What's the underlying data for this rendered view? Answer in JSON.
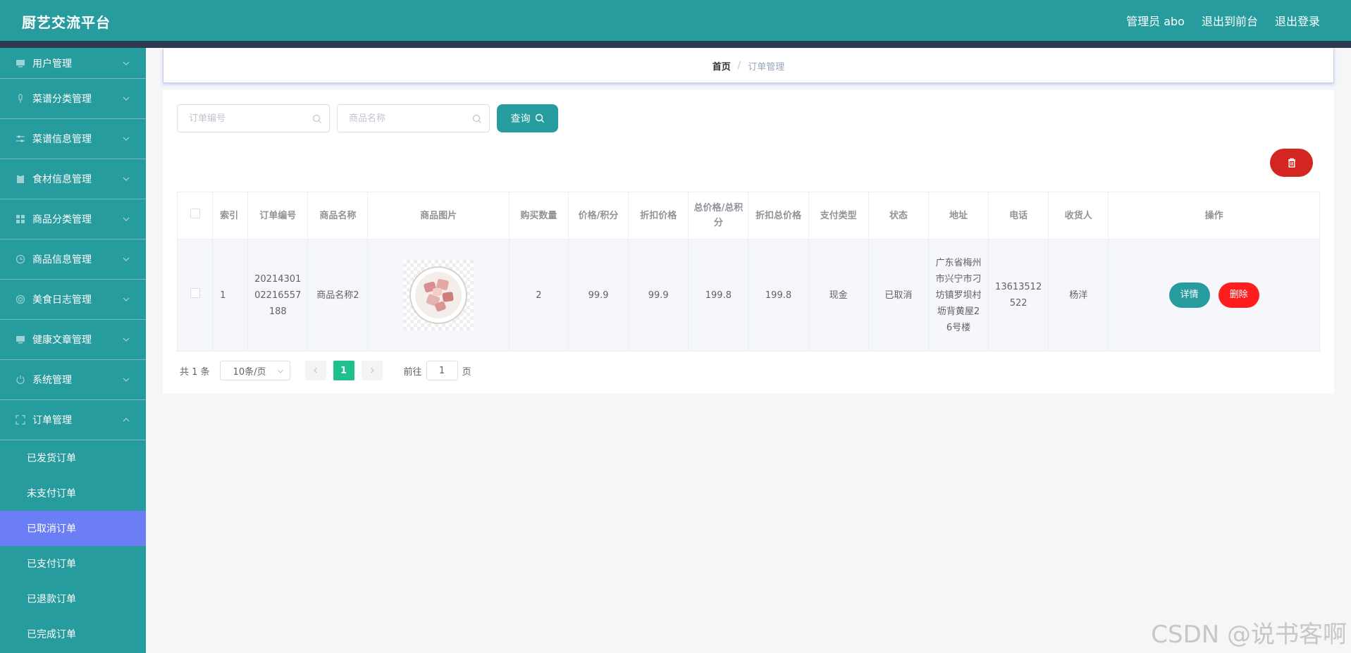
{
  "header": {
    "brand": "厨艺交流平台",
    "admin": "管理员 abo",
    "to_front": "退出到前台",
    "logout": "退出登录"
  },
  "sidebar": {
    "items": [
      {
        "label": "用户管理",
        "icon": "monitor-icon"
      },
      {
        "label": "菜谱分类管理",
        "icon": "microphone-icon"
      },
      {
        "label": "菜谱信息管理",
        "icon": "sliders-icon"
      },
      {
        "label": "食材信息管理",
        "icon": "clipboard-icon"
      },
      {
        "label": "商品分类管理",
        "icon": "grid-icon"
      },
      {
        "label": "商品信息管理",
        "icon": "clock-icon"
      },
      {
        "label": "美食日志管理",
        "icon": "globe-icon"
      },
      {
        "label": "健康文章管理",
        "icon": "monitor-icon"
      },
      {
        "label": "系统管理",
        "icon": "power-icon"
      },
      {
        "label": "订单管理",
        "icon": "fullscreen-icon"
      }
    ],
    "order_sub": [
      {
        "label": "已发货订单"
      },
      {
        "label": "未支付订单"
      },
      {
        "label": "已取消订单"
      },
      {
        "label": "已支付订单"
      },
      {
        "label": "已退款订单"
      },
      {
        "label": "已完成订单"
      }
    ]
  },
  "breadcrumb": {
    "home": "首页",
    "sep": "/",
    "current": "订单管理"
  },
  "search": {
    "order_no_placeholder": "订单编号",
    "goods_name_placeholder": "商品名称",
    "query_label": "查询"
  },
  "table": {
    "columns": [
      "索引",
      "订单编号",
      "商品名称",
      "商品图片",
      "购买数量",
      "价格/积分",
      "折扣价格",
      "总价格/总积分",
      "折扣总价格",
      "支付类型",
      "状态",
      "地址",
      "电话",
      "收货人",
      "操作"
    ],
    "rows": [
      {
        "index": "1",
        "order_no": "2021430102216557188",
        "goods_name": "商品名称2",
        "quantity": "2",
        "price": "99.9",
        "discount_price": "99.9",
        "total_price": "199.8",
        "discount_total": "199.8",
        "pay_type": "现金",
        "status": "已取消",
        "address": "广东省梅州市兴宁市刁坊镇罗坝村坜背黄屋26号楼",
        "phone": "13613512522",
        "receiver": "杨洋"
      }
    ],
    "detail_label": "详情",
    "delete_label": "删除"
  },
  "pager": {
    "total": "共 1 条",
    "page_size": "10条/页",
    "current_page": "1",
    "goto_prefix": "前往",
    "goto_value": "1",
    "goto_suffix": "页"
  },
  "watermark": "CSDN @说书客啊",
  "colors": {
    "primary": "#279c9e",
    "active_menu": "#6c7ef6",
    "danger": "#d32621",
    "delete": "#ff1d1d",
    "pager_active": "#1fc08e"
  }
}
